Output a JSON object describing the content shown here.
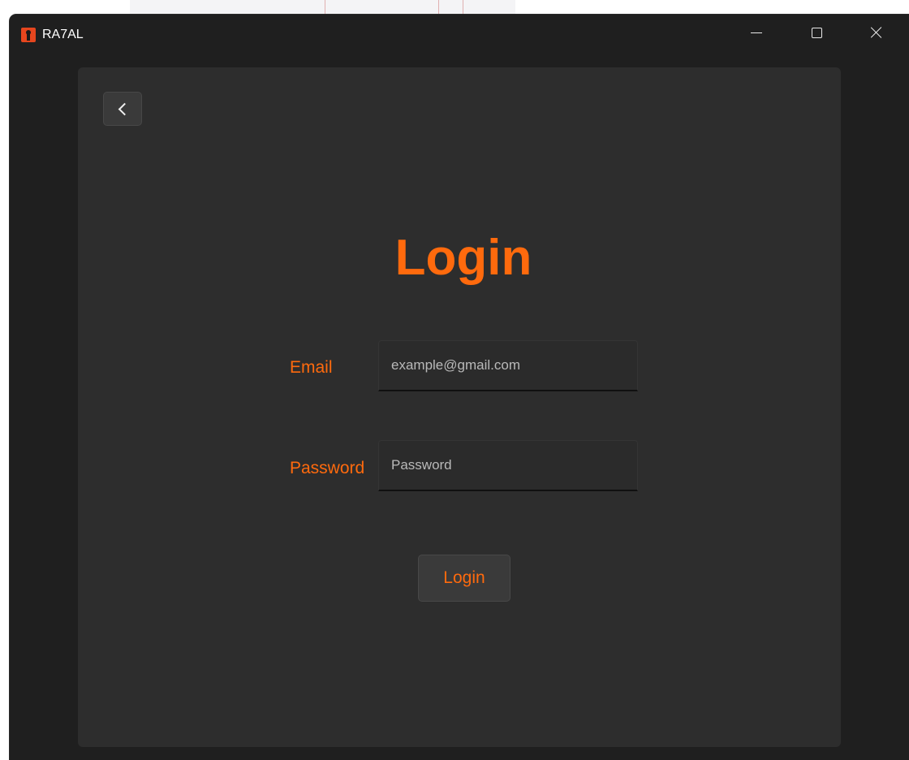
{
  "window": {
    "title": "RA7AL",
    "icon": "app-logo-icon",
    "controls": {
      "minimize": "minimize-icon",
      "maximize": "maximize-icon",
      "close": "close-icon"
    }
  },
  "page": {
    "back_icon": "chevron-left-icon",
    "title": "Login",
    "email": {
      "label": "Email",
      "placeholder": "example@gmail.com",
      "value": ""
    },
    "password": {
      "label": "Password",
      "placeholder": "Password",
      "value": ""
    },
    "submit_label": "Login"
  },
  "colors": {
    "accent": "#ff6a0d",
    "window_bg": "#1f1f1f",
    "panel_bg": "#2d2d2d",
    "button_bg": "#3a3a3a"
  }
}
